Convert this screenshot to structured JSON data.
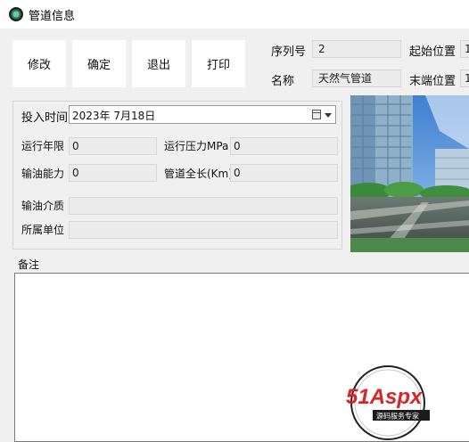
{
  "window": {
    "title": "管道信息"
  },
  "toolbar": {
    "edit": "修改",
    "confirm": "确定",
    "exit": "退出",
    "print": "打印"
  },
  "info": {
    "serial_label": "序列号",
    "serial_value": "2",
    "name_label": "名称",
    "name_value": "天然气管道",
    "start_label": "起始位置",
    "start_value": "1",
    "end_label": "末端位置",
    "end_value": "1"
  },
  "form": {
    "date_label": "投入时间",
    "date_value": "2023年  7月18日",
    "years_label": "运行年限",
    "years_value": "0",
    "pressure_label": "运行压力MPa",
    "pressure_value": "0",
    "capacity_label": "输油能力",
    "capacity_value": "0",
    "length_label": "管道全长(Km)",
    "length_value": "0",
    "medium_label": "输油介质",
    "medium_value": "",
    "unit_label": "所属单位",
    "unit_value": ""
  },
  "remarks": {
    "label": "备注",
    "value": ""
  },
  "watermark": {
    "brand": "51Aspx",
    "tagline": "源码服务专家"
  },
  "colors": {
    "watermark_red": "#d8242a",
    "window_bg": "#f0f0f0",
    "field_bg": "#ececec"
  },
  "icons": {
    "app": "app-icon",
    "date": "calendar-icon",
    "dropdown": "dropdown-arrow-icon"
  }
}
